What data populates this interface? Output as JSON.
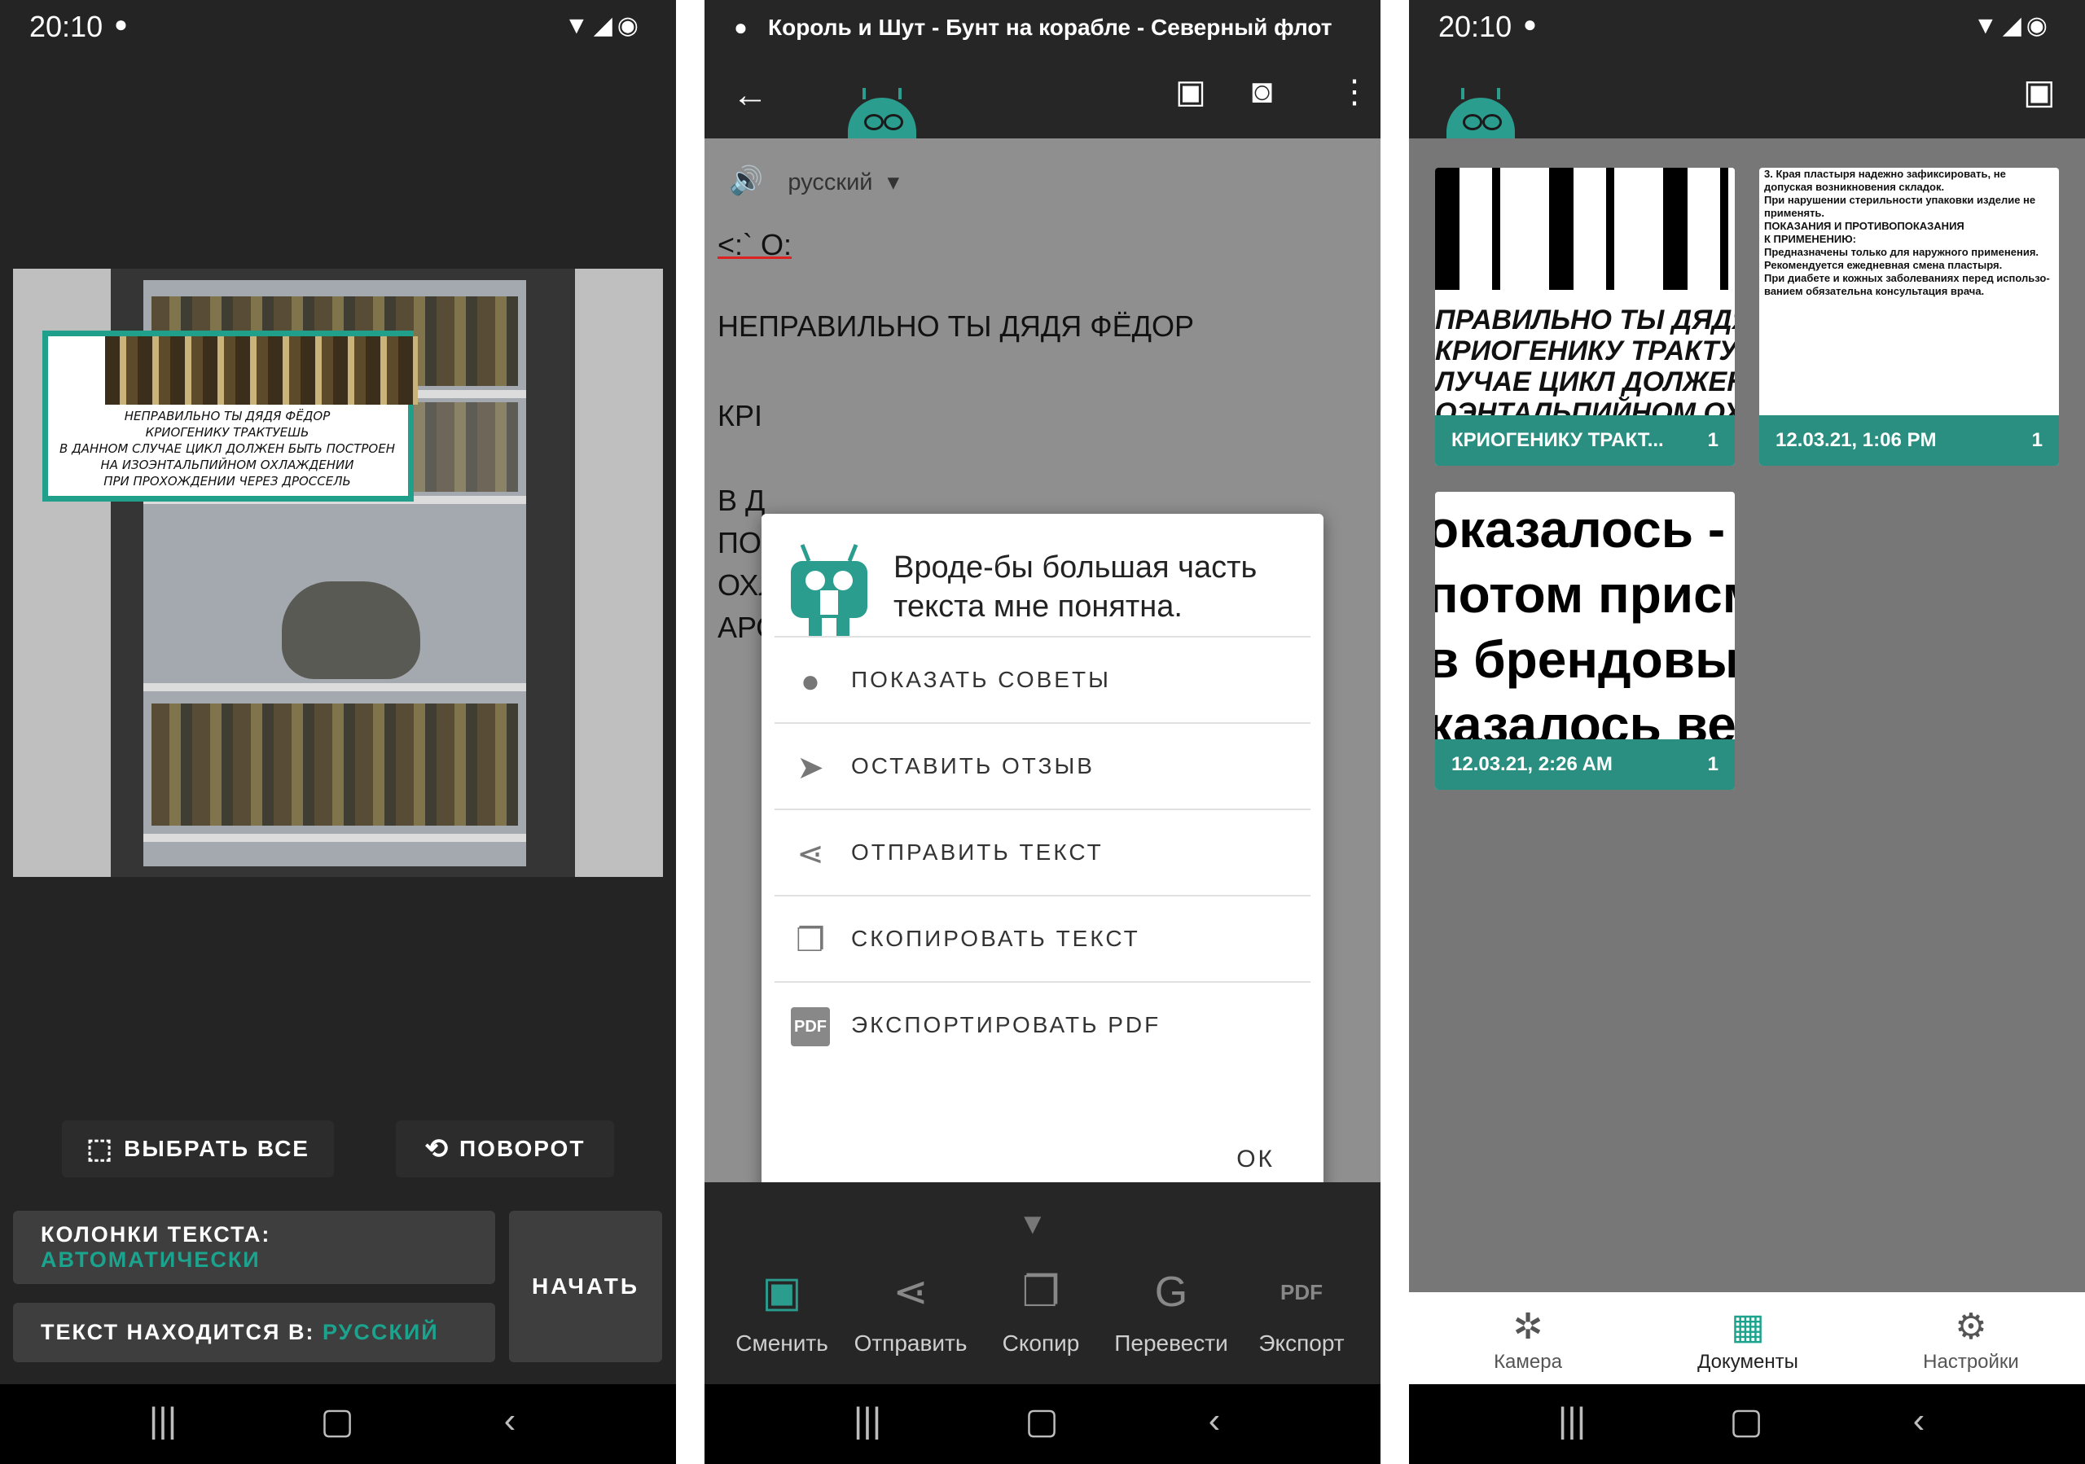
{
  "screen1": {
    "status_time": "20:10",
    "crop_text": [
      "НЕПРАВИЛЬНО ТЫ ДЯДЯ ФЁДОР",
      "КРИОГЕНИКУ ТРАКТУЕШЬ",
      "В ДАННОМ СЛУЧАЕ ЦИКЛ ДОЛЖЕН БЫТЬ ПОСТРОЕН",
      "НА ИЗОЭНТАЛЬПИЙНОМ ОХЛАЖДЕНИИ",
      "ПРИ ПРОХОЖДЕНИИ ЧЕРЕЗ ДРОССЕЛЬ"
    ],
    "select_all_label": "ВЫБРАТЬ ВСЕ",
    "rotate_label": "ПОВОРОТ",
    "columns_label": "КОЛОНКИ ТЕКСТА:",
    "columns_value": "АВТОМАТИЧЕСКИ",
    "lang_label": "ТЕКСТ НАХОДИТСЯ В:",
    "lang_value": "РУССКИЙ",
    "start_label": "НАЧАТЬ"
  },
  "screen2": {
    "title": "Король и Шут - Бунт на корабле - Северный флот",
    "language": "русский",
    "ocr_lines": [
      "<:` О:",
      "НЕПРАВИЛЬНО ТЫ ДЯДЯ ФЁДОР",
      "КРІ",
      "В Д",
      "ПО",
      "ОХЛ",
      "АРО"
    ],
    "dialog": {
      "title": "Вроде-бы большая часть текста мне понятна.",
      "items": [
        "ПОКАЗАТЬ СОВЕТЫ",
        "ОСТАВИТЬ ОТЗЫВ",
        "ОТПРАВИТЬ ТЕКСТ",
        "СКОПИРОВАТЬ ТЕКСТ",
        "ЭКСПОРТИРОВАТЬ PDF"
      ],
      "ok": "ОК"
    },
    "bottom_actions": [
      "Сменить",
      "Отправить",
      "Скопир",
      "Перевести",
      "Экспорт"
    ]
  },
  "screen3": {
    "status_time": "20:10",
    "cards": [
      {
        "label": "КРИОГЕНИКУ ТРАКТ...",
        "count": "1",
        "preview": [
          "ПРАВИЛЬНО ТЫ ДЯДЯ ФЁДОР",
          "КРИОГЕНИКУ ТРАКТУЕШЬ",
          "ЛУЧАЕ ЦИКЛ ДОЛЖЕН БЫТЬ",
          "ОЭНТАЛЬПИЙНОМ ОХЛАЖДЕ"
        ]
      },
      {
        "label": "12.03.21, 1:06 PM",
        "count": "1",
        "preview": [
          "3. Края пластыря надежно зафиксировать, не",
          "допуская возникновения складок.",
          "При нарушении стерильности упаковки изделие не применять.",
          "ПОКАЗАНИЯ И ПРОТИВОПОКАЗАНИЯ",
          "К ПРИМЕНЕНИЮ:",
          "Предназначены только для наружного применения.",
          "Рекомендуется ежедневная смена пластыря.",
          "При диабете и кожных заболеваниях перед использо-",
          "ванием обязательна консультация врача."
        ]
      },
      {
        "label": "12.03.21, 2:26 AM",
        "count": "1",
        "preview": [
          "оказалось - б",
          "потом присм",
          " в брендовы",
          "казалось ве"
        ]
      }
    ],
    "nav": [
      "Камера",
      "Документы",
      "Настройки"
    ]
  }
}
